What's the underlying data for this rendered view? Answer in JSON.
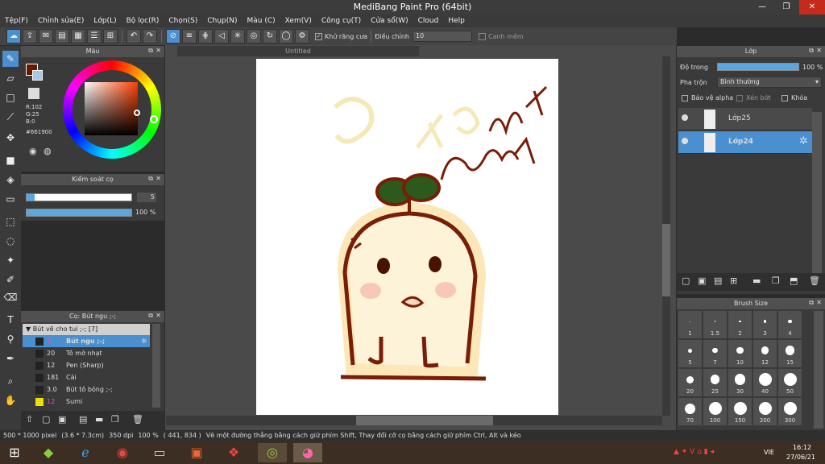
{
  "window": {
    "title": "MediBang Paint Pro (64bit)"
  },
  "menu": [
    "Tệp(F)",
    "Chỉnh sửa(E)",
    "Lớp(L)",
    "Bộ lọc(R)",
    "Chọn(S)",
    "Chụp(N)",
    "Màu (C)",
    "Xem(V)",
    "Công cụ(T)",
    "Cửa sổ(W)",
    "Cloud",
    "Help"
  ],
  "toolbar": {
    "antialias": "Khử răng cưa",
    "adjust_label": "Điều chỉnh",
    "adjust_value": "10",
    "edge": "Canh mềm"
  },
  "color_panel": {
    "title": "Màu",
    "r": "R:102",
    "g": "G:25",
    "b": "B:0",
    "hex": "#661900",
    "main_color": "#661900"
  },
  "brush_control": {
    "title": "Kiểm soát cọ",
    "size": "5",
    "opacity": "100 %"
  },
  "brush_panel": {
    "title": "Cọ: Bút ngu ;-;",
    "group": "Bút vẽ cho tui ;-; [7]",
    "items": [
      {
        "size": "5",
        "name": "Bút ngu ;-;"
      },
      {
        "size": "20",
        "name": "Tô mờ nhạt"
      },
      {
        "size": "12",
        "name": "Pen (Sharp)"
      },
      {
        "size": "181",
        "name": "Cái"
      },
      {
        "size": "3.0",
        "name": "Bút tô bóng ;-;"
      },
      {
        "size": "12",
        "name": "Sumi"
      }
    ]
  },
  "document": {
    "tab": "Untitled"
  },
  "layer_panel": {
    "title": "Lớp",
    "opacity_label": "Độ trong",
    "opacity_value": "100 %",
    "blend_label": "Pha trộn",
    "blend_value": "Bình thường",
    "protect_alpha": "Bảo vệ alpha",
    "clip": "Xén bớt",
    "lock": "Khóa",
    "layers": [
      "Lớp25",
      "Lớp24"
    ]
  },
  "brush_size_panel": {
    "title": "Brush Size",
    "sizes": [
      "1",
      "1.5",
      "2",
      "3",
      "4",
      "5",
      "7",
      "10",
      "12",
      "15",
      "20",
      "25",
      "30",
      "40",
      "50",
      "70",
      "100",
      "150",
      "200",
      "300"
    ]
  },
  "statusbar": {
    "size": "500 * 1000 pixel",
    "cm": "(3.6 * 7.3cm)",
    "dpi": "350 dpi",
    "zoom": "100 %",
    "coord": "( 441, 834 )",
    "hint": "Vẽ một đường thẳng bằng cách giữ phím Shift, Thay đổi cỡ cọ bằng cách giữ phím Ctrl, Alt và kéo"
  },
  "taskbar": {
    "lang": "VIE",
    "time": "16:12",
    "date": "27/06/21"
  }
}
